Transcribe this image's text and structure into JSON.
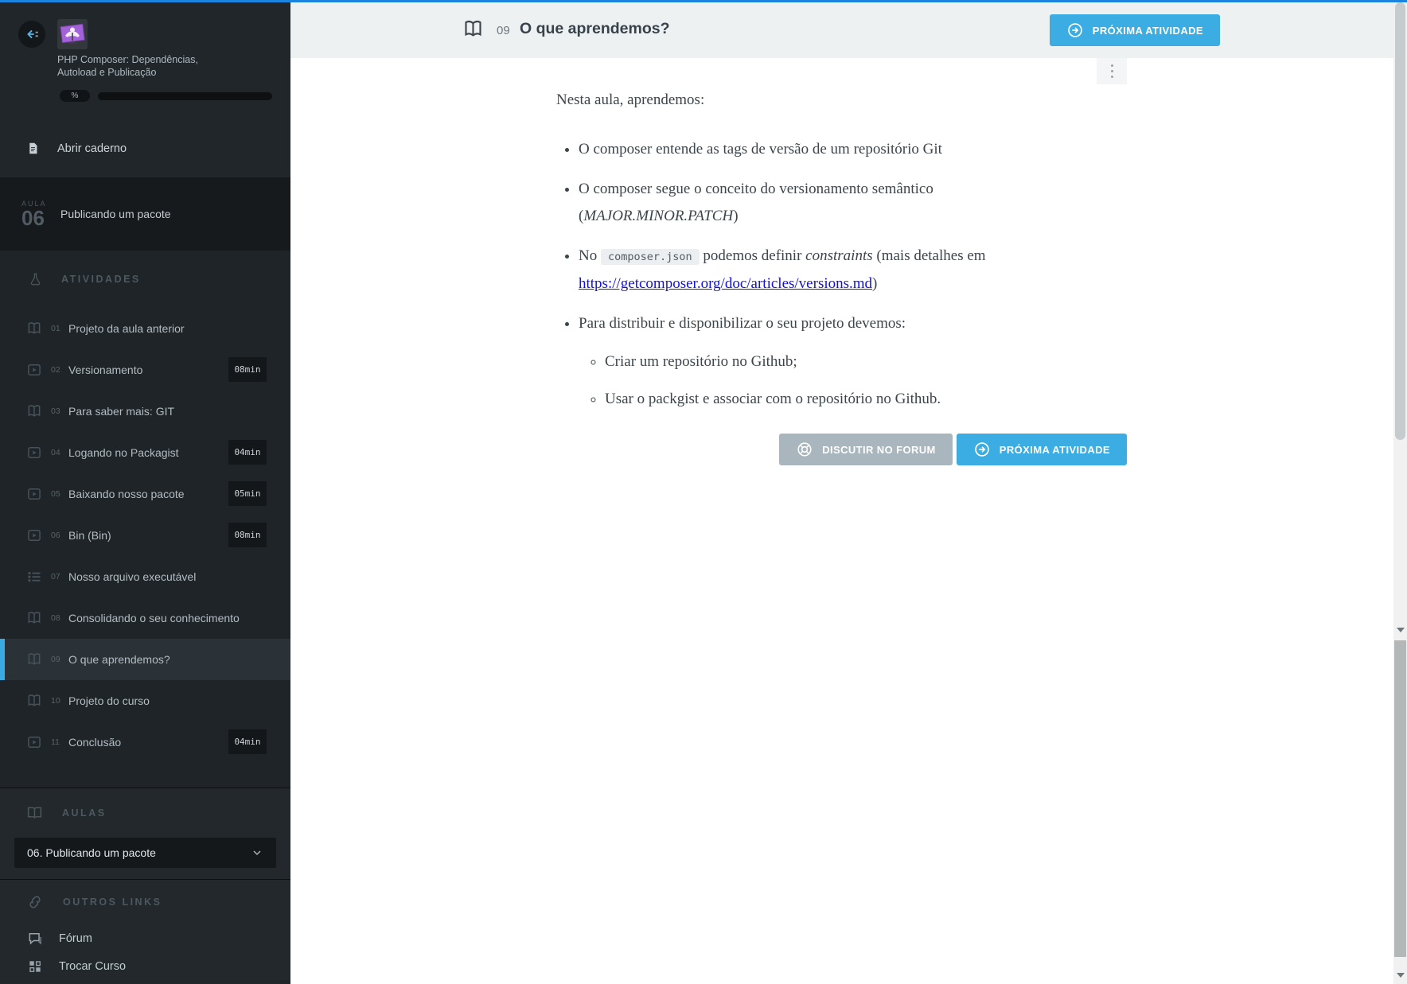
{
  "colors": {
    "accent_blue": "#3bade2",
    "topline_blue": "#1a84e0",
    "link_blue": "#1412d6",
    "brand_purple": "#a462d8"
  },
  "sidebar": {
    "course": {
      "title_line1": "PHP Composer: Dependências,",
      "title_line2": "Autoload e Publicação",
      "progress_badge": "%"
    },
    "open_notebook_label": "Abrir caderno",
    "lesson": {
      "word": "AULA",
      "number": "06",
      "title": "Publicando um pacote"
    },
    "activities_header": "ATIVIDADES",
    "activities": [
      {
        "num": "01",
        "label": "Projeto da aula anterior",
        "icon": "book",
        "duration": ""
      },
      {
        "num": "02",
        "label": "Versionamento",
        "icon": "video",
        "duration": "08min"
      },
      {
        "num": "03",
        "label": "Para saber mais: GIT",
        "icon": "book",
        "duration": ""
      },
      {
        "num": "04",
        "label": "Logando no Packagist",
        "icon": "video",
        "duration": "04min"
      },
      {
        "num": "05",
        "label": "Baixando nosso pacote",
        "icon": "video",
        "duration": "05min"
      },
      {
        "num": "06",
        "label": "Bin (Bin)",
        "icon": "video",
        "duration": "08min"
      },
      {
        "num": "07",
        "label": "Nosso arquivo executável",
        "icon": "list",
        "duration": ""
      },
      {
        "num": "08",
        "label": "Consolidando o seu conhecimento",
        "icon": "book",
        "duration": ""
      },
      {
        "num": "09",
        "label": "O que aprendemos?",
        "icon": "book",
        "duration": "",
        "active": true
      },
      {
        "num": "10",
        "label": "Projeto do curso",
        "icon": "book",
        "duration": ""
      },
      {
        "num": "11",
        "label": "Conclusão",
        "icon": "video",
        "duration": "04min"
      }
    ],
    "aulas_header": "AULAS",
    "lesson_select_value": "06. Publicando um pacote",
    "other_links_header": "OUTROS LINKS",
    "links": [
      {
        "label": "Fórum",
        "icon": "forum"
      },
      {
        "label": "Trocar Curso",
        "icon": "grid"
      }
    ]
  },
  "header": {
    "activity_number": "09",
    "title": "O que aprendemos?",
    "next_button_label": "PRÓXIMA ATIVIDADE"
  },
  "content": {
    "intro": "Nesta aula, aprendemos:",
    "bullet1": "O composer entende as tags de versão de um repositório Git",
    "bullet2": {
      "text": "O composer segue o conceito do versionamento semântico",
      "open": "(",
      "italic": "MAJOR.MINOR.PATCH",
      "close": ")"
    },
    "bullet3": {
      "pre": "No ",
      "code": "composer.json",
      "mid": " podemos definir ",
      "italic": "constraints",
      "mid2": " (mais detalhes em ",
      "link": "https://getcomposer.org/doc/articles/versions.md",
      "suffix": ")"
    },
    "bullet4": {
      "text": "Para distribuir e disponibilizar o seu projeto devemos:",
      "sub": [
        "Criar um repositório no Github;",
        "Usar o packgist e associar com o repositório no Github."
      ]
    },
    "footer": {
      "forum_button_label": "DISCUTIR NO FORUM",
      "next_button_label": "PRÓXIMA ATIVIDADE"
    }
  }
}
